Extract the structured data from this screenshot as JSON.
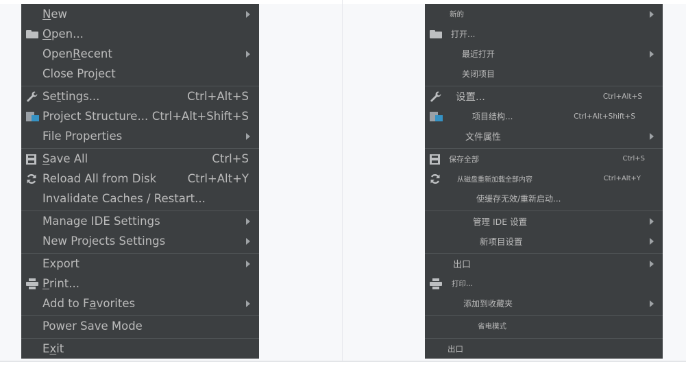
{
  "left_menu": {
    "new": {
      "pre": "",
      "u": "N",
      "post": "ew"
    },
    "open": {
      "pre": "",
      "u": "O",
      "post": "pen..."
    },
    "open_recent": {
      "pre": "Open ",
      "u": "R",
      "post": "ecent"
    },
    "close_project": {
      "pre": "Close Pro",
      "u": "j",
      "post": "ect"
    },
    "settings": {
      "pre": "Se",
      "u": "t",
      "post": "tings...",
      "shortcut": "Ctrl+Alt+S"
    },
    "project_structure": {
      "label": "Project Structure...",
      "shortcut": "Ctrl+Alt+Shift+S"
    },
    "file_properties": {
      "label": "File Properties"
    },
    "save_all": {
      "pre": "",
      "u": "S",
      "post": "ave All",
      "shortcut": "Ctrl+S"
    },
    "reload": {
      "label": "Reload All from Disk",
      "shortcut": "Ctrl+Alt+Y"
    },
    "invalidate": {
      "label": "Invalidate Caches / Restart..."
    },
    "manage_ide": {
      "label": "Manage IDE Settings"
    },
    "new_projects_settings": {
      "label": "New Projects Settings"
    },
    "export": {
      "label": "Export"
    },
    "print": {
      "pre": "",
      "u": "P",
      "post": "rint..."
    },
    "add_to_favorites": {
      "pre": "Add to F",
      "u": "a",
      "post": "vorites"
    },
    "power_save": {
      "label": "Power Save Mode"
    },
    "exit": {
      "pre": "E",
      "u": "x",
      "post": "it"
    }
  },
  "right_menu": {
    "new": {
      "label": "新的"
    },
    "open": {
      "label": "打开..."
    },
    "open_recent": {
      "label": "最近打开"
    },
    "close_project": {
      "label": "关闭项目"
    },
    "settings": {
      "label": "设置...",
      "shortcut": "Ctrl+Alt+S"
    },
    "project_structure": {
      "label": "项目结构...",
      "shortcut": "Ctrl+Alt+Shift+S"
    },
    "file_properties": {
      "label": "文件属性"
    },
    "save_all": {
      "label": "保存全部",
      "shortcut": "Ctrl+S"
    },
    "reload": {
      "label": "从磁盘重新加载全部内容",
      "shortcut": "Ctrl+Alt+Y"
    },
    "invalidate": {
      "label": "使缓存无效/重新启动..."
    },
    "manage_ide": {
      "label": "管理 IDE 设置"
    },
    "new_projects_settings": {
      "label": "新项目设置"
    },
    "export": {
      "label": "出口"
    },
    "print": {
      "label": "打印..."
    },
    "add_to_favorites": {
      "label": "添加到收藏夹"
    },
    "power_save": {
      "label": "省电模式"
    },
    "exit": {
      "label": "出口"
    }
  },
  "icons": {
    "open": "folder-icon",
    "settings": "wrench-icon",
    "project_structure": "project-structure-icon",
    "save_all": "save-icon",
    "reload": "reload-icon",
    "print": "printer-icon",
    "submenu": "chevron-right-icon"
  },
  "colors": {
    "menu_background": "#3c3f41",
    "menu_text": "#bbbbbb",
    "separator": "#515557",
    "page_background": "#f7f8fa",
    "structure_icon_accent": "#3592c4"
  }
}
